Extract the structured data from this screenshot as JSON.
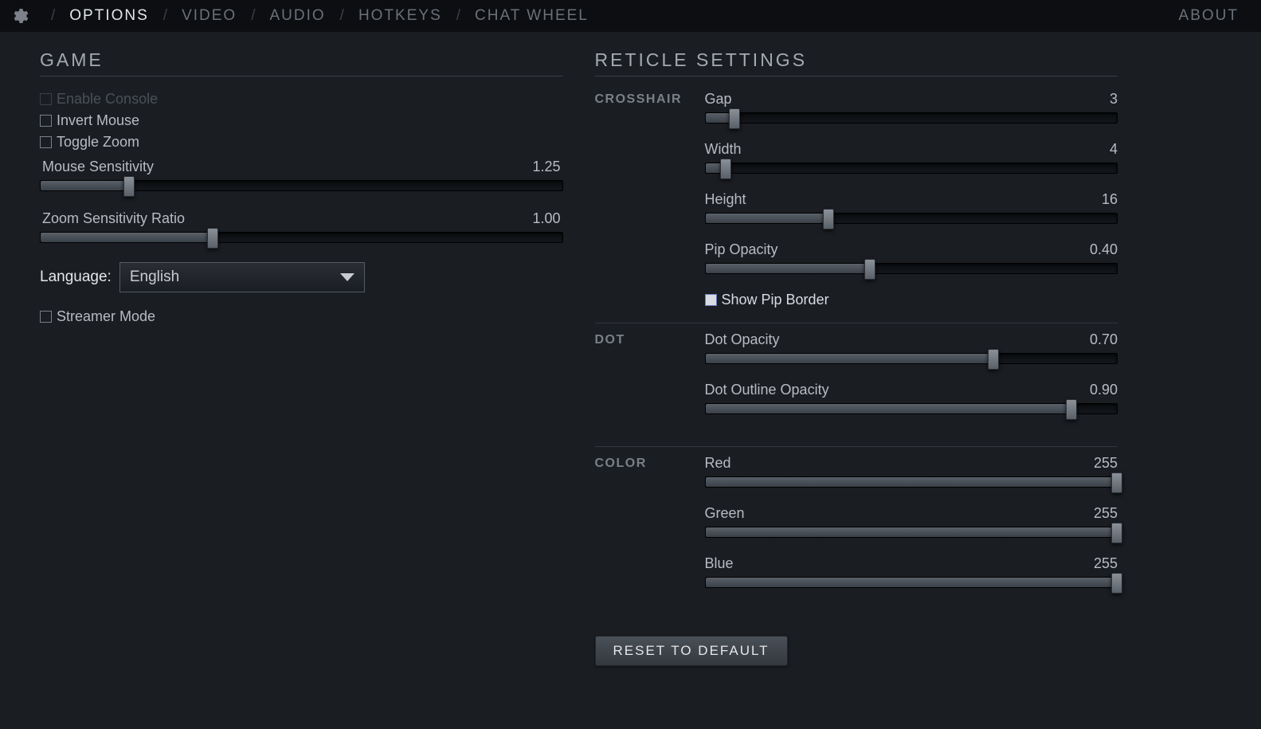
{
  "topbar": {
    "tabs": [
      "OPTIONS",
      "VIDEO",
      "AUDIO",
      "HOTKEYS",
      "CHAT WHEEL"
    ],
    "active_index": 0,
    "about": "ABOUT"
  },
  "game": {
    "title": "GAME",
    "enable_console": {
      "label": "Enable Console",
      "checked": false,
      "disabled": true
    },
    "invert_mouse": {
      "label": "Invert Mouse",
      "checked": false
    },
    "toggle_zoom": {
      "label": "Toggle Zoom",
      "checked": false
    },
    "mouse_sens": {
      "label": "Mouse Sensitivity",
      "value": "1.25",
      "pct": 17
    },
    "zoom_ratio": {
      "label": "Zoom Sensitivity Ratio",
      "value": "1.00",
      "pct": 33
    },
    "language_label": "Language:",
    "language_value": "English",
    "streamer_mode": {
      "label": "Streamer Mode",
      "checked": false
    }
  },
  "reticle": {
    "title": "RETICLE SETTINGS",
    "crosshair": {
      "title": "CROSSHAIR",
      "gap": {
        "label": "Gap",
        "value": "3",
        "pct": 7
      },
      "width": {
        "label": "Width",
        "value": "4",
        "pct": 5
      },
      "height": {
        "label": "Height",
        "value": "16",
        "pct": 30
      },
      "pip_opacity": {
        "label": "Pip Opacity",
        "value": "0.40",
        "pct": 40
      },
      "show_pip_border": {
        "label": "Show Pip Border",
        "checked": true
      }
    },
    "dot": {
      "title": "DOT",
      "dot_opacity": {
        "label": "Dot Opacity",
        "value": "0.70",
        "pct": 70
      },
      "dot_outline": {
        "label": "Dot Outline Opacity",
        "value": "0.90",
        "pct": 89
      }
    },
    "color": {
      "title": "COLOR",
      "red": {
        "label": "Red",
        "value": "255",
        "pct": 100
      },
      "green": {
        "label": "Green",
        "value": "255",
        "pct": 100
      },
      "blue": {
        "label": "Blue",
        "value": "255",
        "pct": 100
      }
    },
    "reset": "RESET TO DEFAULT"
  }
}
